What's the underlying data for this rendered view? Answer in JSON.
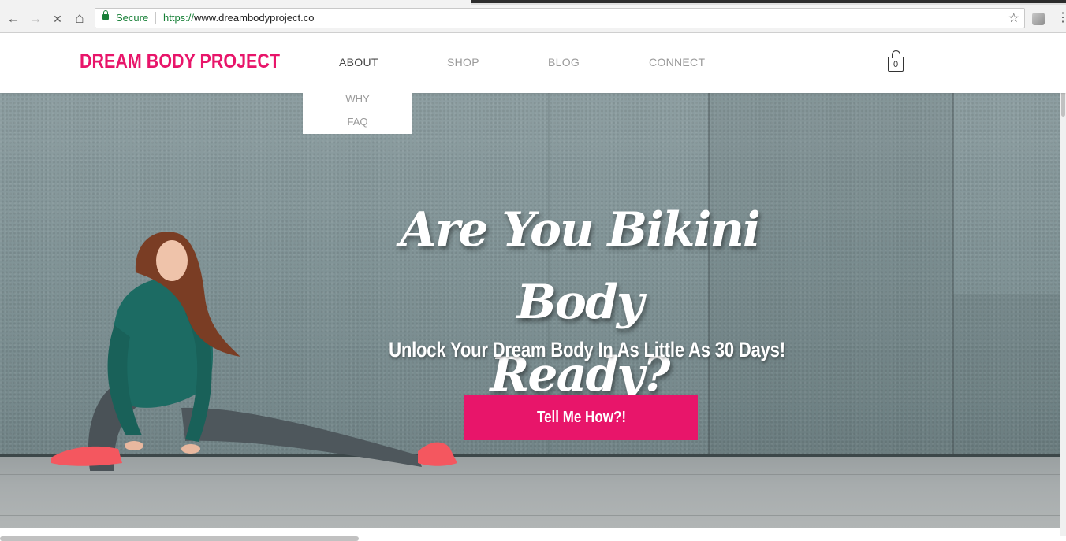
{
  "browser": {
    "secure_label": "Secure",
    "url_scheme": "https://",
    "url_host": "www.dreambodyproject.co",
    "back_icon": "←",
    "forward_icon": "→",
    "stop_icon": "✕",
    "home_icon": "⌂",
    "star_icon": "☆",
    "menu_icon": "⋮"
  },
  "site": {
    "logo": "DREAM BODY PROJECT",
    "brand_color": "#e8156a",
    "nav": [
      "ABOUT",
      "SHOP",
      "BLOG",
      "CONNECT"
    ],
    "active_nav": "ABOUT",
    "dropdown": [
      "WHY",
      "FAQ"
    ],
    "cart_count": "0"
  },
  "hero": {
    "headline_line1": "Are You Bikini Body",
    "headline_line2": "Ready?",
    "subheadline": "Unlock Your Dream Body In As Little As 30 Days!",
    "cta": "Tell Me How?!"
  }
}
